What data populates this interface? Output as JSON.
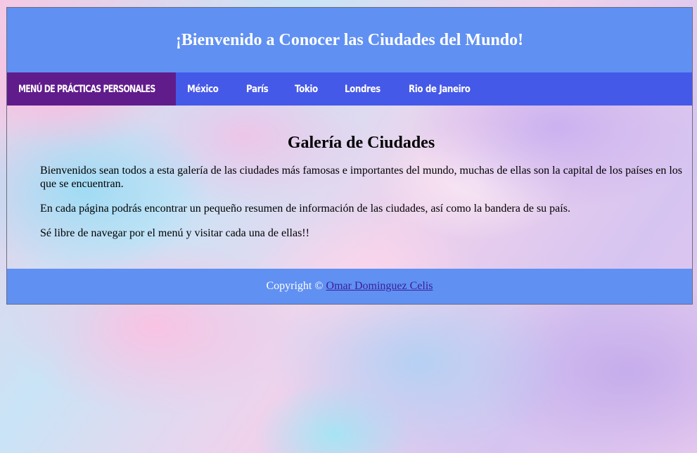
{
  "header": {
    "title": "¡Bienvenido a Conocer las Ciudades del Mundo!"
  },
  "nav": {
    "brand": "MENÚ DE PRÁCTICAS PERSONALES",
    "links": [
      "México",
      "París",
      "Tokio",
      "Londres",
      "Rio de Janeiro"
    ]
  },
  "main": {
    "heading": "Galería de Ciudades",
    "paragraphs": [
      "Bienvenidos sean todos a esta galería de las ciudades más famosas e importantes del mundo, muchas de ellas son la capital de los países en los que se encuentran.",
      "En cada página podrás encontrar un pequeño resumen de información de las ciudades, así como la bandera de su país.",
      "Sé libre de navegar por el menú y visitar cada una de ellas!!"
    ]
  },
  "footer": {
    "copyright_text": "Copyright ©",
    "author_link": "Omar Dominguez Celis"
  },
  "colors": {
    "header_bg": "#6090f2",
    "nav_bg": "#4559e8",
    "nav_brand_bg": "#611c8c",
    "footer_bg": "#6090f2",
    "link": "#3a1f9c"
  }
}
